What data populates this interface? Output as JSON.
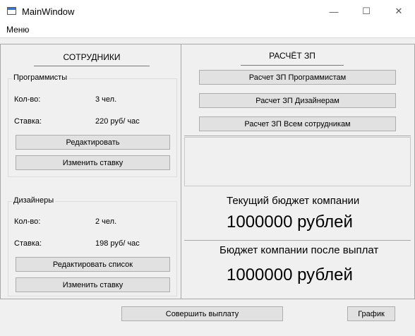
{
  "window": {
    "title": "MainWindow",
    "min_glyph": "—",
    "max_glyph": "☐",
    "close_glyph": "✕"
  },
  "menubar": {
    "menu_label": "Меню"
  },
  "employees": {
    "header": "СОТРУДНИКИ",
    "programmers": {
      "title": "Программисты",
      "count_label": "Кол-во:",
      "count_value": "3 чел.",
      "rate_label": "Ставка:",
      "rate_value": "220 руб/ час",
      "edit_button": "Редактировать",
      "change_rate_button": "Изменить ставку"
    },
    "designers": {
      "title": "Дизайнеры",
      "count_label": "Кол-во:",
      "count_value": "2 чел.",
      "rate_label": "Ставка:",
      "rate_value": "198 руб/ час",
      "edit_button": "Редактировать список",
      "change_rate_button": "Изменить ставку"
    }
  },
  "salary": {
    "header": "РАСЧЁТ ЗП",
    "calc_programmers": "Расчет ЗП Программистам",
    "calc_designers": "Расчет ЗП Дизайнерам",
    "calc_all": "Расчет ЗП Всем сотрудникам",
    "current_budget_title": "Текущий бюджет компании",
    "current_budget_value": "1000000 рублей",
    "after_budget_title": "Бюджет компании после выплат",
    "after_budget_value": "1000000 рублей"
  },
  "footer": {
    "pay_button": "Совершить выплату",
    "chart_button": "График"
  }
}
